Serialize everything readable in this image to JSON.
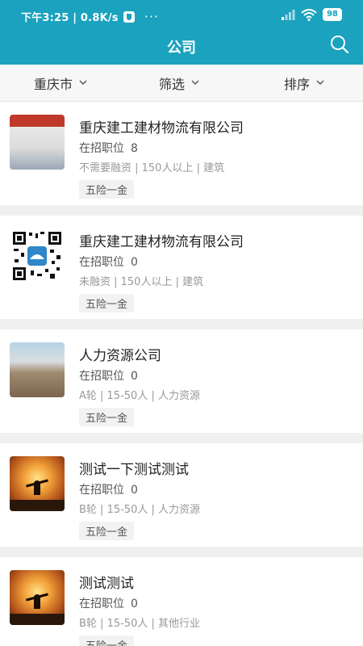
{
  "statusbar": {
    "time_speed": "下午3:25 | 0.8K/s",
    "more": "···",
    "battery": "98"
  },
  "header": {
    "title": "公司"
  },
  "filters": [
    {
      "label": "重庆市"
    },
    {
      "label": "筛选"
    },
    {
      "label": "排序"
    }
  ],
  "companies": [
    {
      "name": "重庆建工建材物流有限公司",
      "jobs_label": "在招职位",
      "jobs_count": "8",
      "meta": "不需要融资 | 150人以上 | 建筑",
      "tag": "五险一金",
      "logo": "people-photo"
    },
    {
      "name": "重庆建工建材物流有限公司",
      "jobs_label": "在招职位",
      "jobs_count": "0",
      "meta": "未融资 | 150人以上 | 建筑",
      "tag": "五险一金",
      "logo": "qr-code"
    },
    {
      "name": "人力资源公司",
      "jobs_label": "在招职位",
      "jobs_count": "0",
      "meta": "A轮 | 15-50人 | 人力资源",
      "tag": "五险一金",
      "logo": "landscape-photo"
    },
    {
      "name": "测试一下测试测试",
      "jobs_label": "在招职位",
      "jobs_count": "0",
      "meta": "B轮 | 15-50人 | 人力资源",
      "tag": "五险一金",
      "logo": "sunset-photo"
    },
    {
      "name": "测试测试",
      "jobs_label": "在招职位",
      "jobs_count": "0",
      "meta": "B轮 | 15-50人 | 其他行业",
      "tag": "五险一金",
      "logo": "sunset-photo"
    }
  ],
  "colors": {
    "primary": "#1aa2be",
    "background": "#f0f0f0"
  }
}
